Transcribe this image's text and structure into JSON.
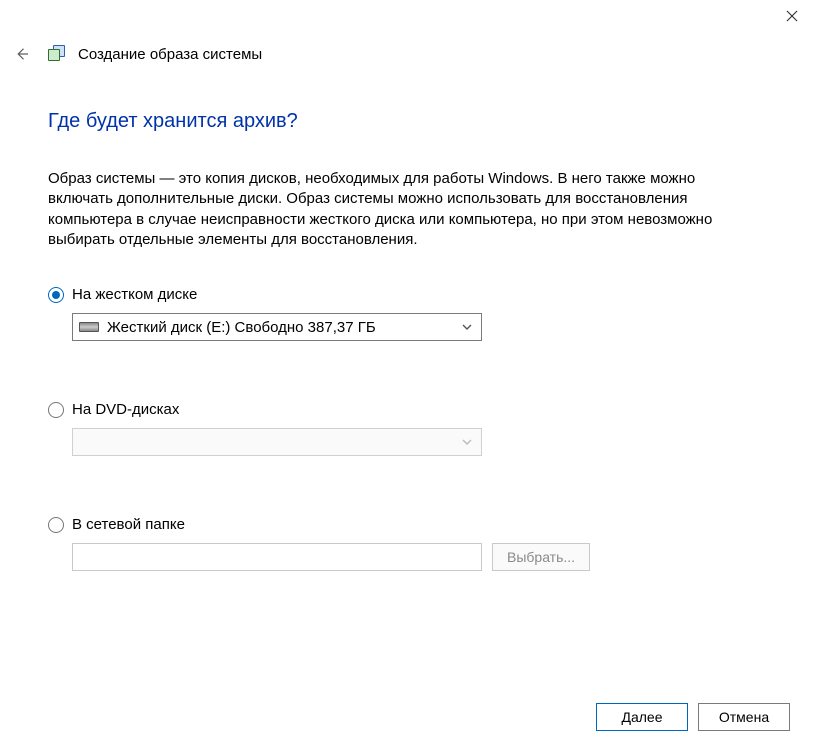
{
  "window": {
    "title": "Создание образа системы"
  },
  "page": {
    "heading": "Где будет хранится архив?",
    "description": "Образ системы — это копия дисков, необходимых для работы Windows. В него также можно включать дополнительные диски. Образ системы можно использовать для восстановления компьютера в случае неисправности жесткого диска или компьютера, но при этом невозможно выбирать отдельные элементы для восстановления."
  },
  "options": {
    "hdd": {
      "label": "На жестком диске",
      "selected_text": "Жесткий диск (E:)  Свободно 387,37 ГБ",
      "checked": true
    },
    "dvd": {
      "label": "На DVD-дисках",
      "checked": false
    },
    "network": {
      "label": "В сетевой папке",
      "checked": false,
      "path": "",
      "browse_label": "Выбрать..."
    }
  },
  "footer": {
    "next": "Далее",
    "cancel": "Отмена"
  }
}
